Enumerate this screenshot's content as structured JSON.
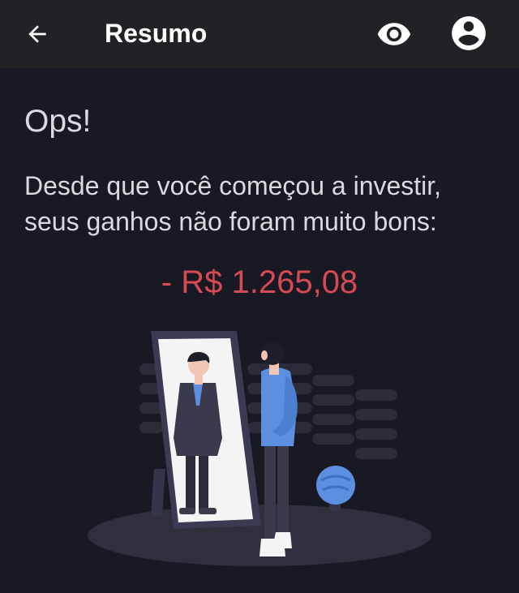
{
  "appbar": {
    "title": "Resumo",
    "back_icon": "arrow-left-icon",
    "visibility_icon": "eye-icon",
    "account_icon": "account-circle-icon"
  },
  "content": {
    "heading": "Ops!",
    "message": "Desde que você começou a investir, seus ganhos não foram muito bons:",
    "amount": "- R$ 1.265,08"
  },
  "colors": {
    "background": "#191923",
    "appbar": "#222226",
    "amount": "#d64a55",
    "accent_blue": "#5c8fe0"
  }
}
